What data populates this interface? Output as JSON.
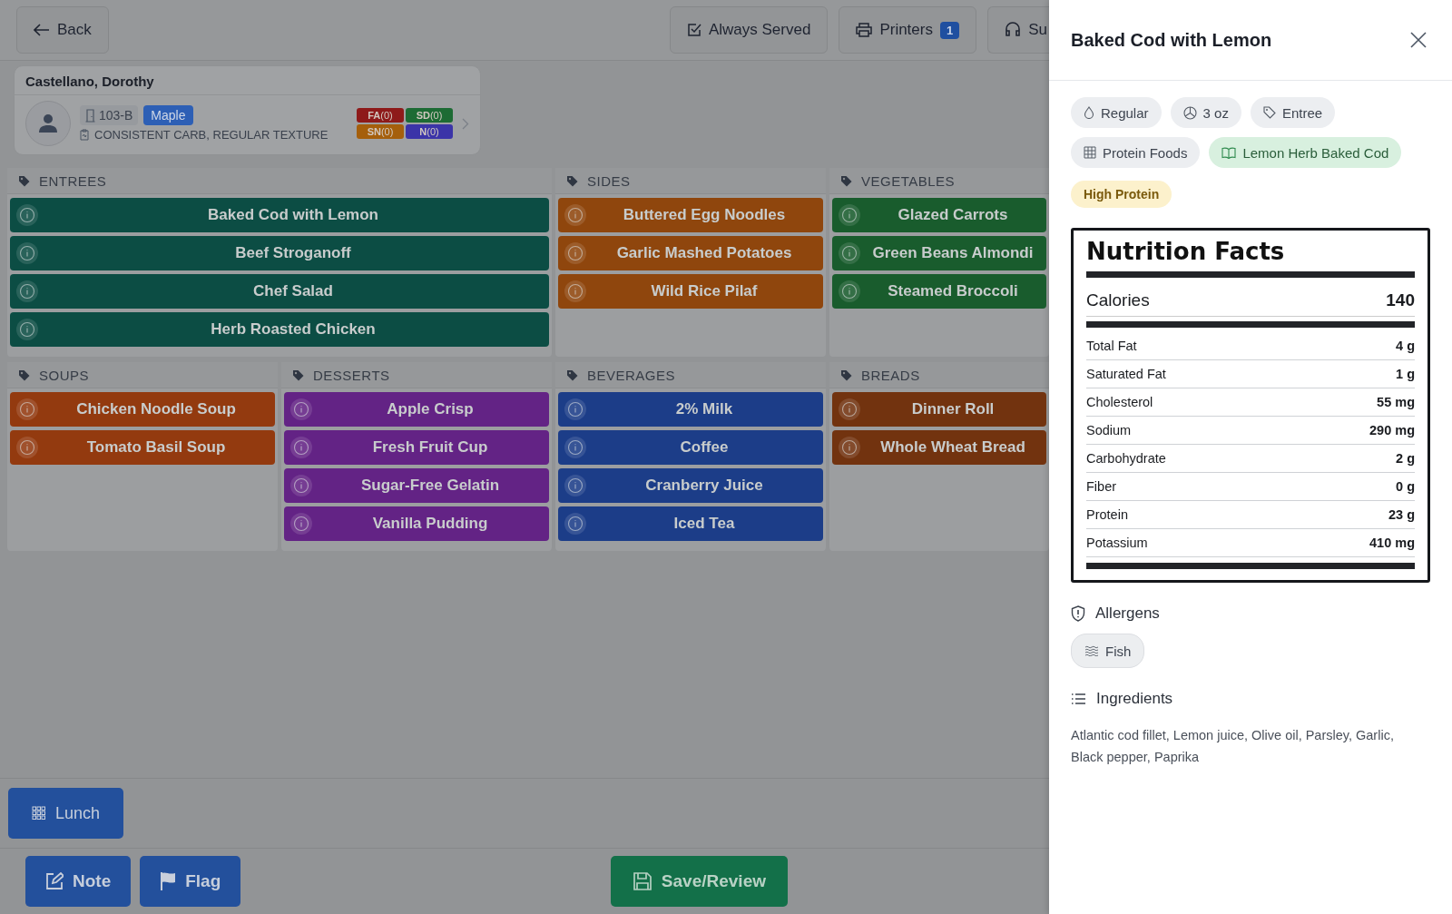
{
  "header": {
    "back": "Back",
    "buttons": [
      {
        "label": "Always Served"
      },
      {
        "label": "Printers",
        "badge": "1"
      },
      {
        "label": "Su"
      }
    ]
  },
  "patient": {
    "name": "Castellano, Dorothy",
    "room": "103-B",
    "unit": "Maple",
    "diet": "CONSISTENT CARB, REGULAR TEXTURE",
    "flags": [
      {
        "text": "**FA**(0)",
        "color": "#8e1a1a"
      },
      {
        "text": "**SD**(0)",
        "color": "#1d6b34"
      },
      {
        "text": "**SN**(0)",
        "color": "#a55f0c"
      },
      {
        "text": "**N**(0)",
        "color": "#3b34a8"
      }
    ]
  },
  "categories": [
    {
      "name": "ENTREES",
      "color": "#0c4d44",
      "wide": true,
      "items": [
        "Baked Cod with Lemon",
        "Beef Stroganoff",
        "Chef Salad",
        "Herb Roasted Chicken"
      ]
    },
    {
      "name": "SIDES",
      "color": "#8f460d",
      "wide": false,
      "items": [
        "Buttered Egg Noodles",
        "Garlic Mashed Potatoes",
        "Wild Rice Pilaf"
      ]
    },
    {
      "name": "VEGETABLES",
      "color": "#195c2d",
      "wide": false,
      "items": [
        "Glazed Carrots",
        "Green Beans Almondi",
        "Steamed Broccoli"
      ]
    },
    {
      "name": "SOUPS",
      "color": "#933a0f",
      "wide": false,
      "items": [
        "Chicken Noodle Soup",
        "Tomato Basil Soup"
      ]
    },
    {
      "name": "DESSERTS",
      "color": "#632385",
      "wide": false,
      "items": [
        "Apple Crisp",
        "Fresh Fruit Cup",
        "Sugar-Free Gelatin",
        "Vanilla Pudding"
      ]
    },
    {
      "name": "BEVERAGES",
      "color": "#1c3d88",
      "wide": false,
      "items": [
        "2% Milk",
        "Coffee",
        "Cranberry Juice",
        "Iced Tea"
      ]
    },
    {
      "name": "BREADS",
      "color": "#72330f",
      "wide": false,
      "items": [
        "Dinner Roll",
        "Whole Wheat Bread"
      ]
    }
  ],
  "meal": "Lunch",
  "footer": {
    "note": "Note",
    "flag": "Flag",
    "save": "Save/Review"
  },
  "panel": {
    "title": "Baked Cod with Lemon",
    "chips": [
      {
        "label": "Regular",
        "kind": "plain"
      },
      {
        "label": "3 oz",
        "kind": "plain"
      },
      {
        "label": "Entree",
        "kind": "plain"
      },
      {
        "label": "Protein Foods",
        "kind": "plain"
      },
      {
        "label": "Lemon Herb Baked Cod",
        "kind": "recipe"
      },
      {
        "label": "High Protein",
        "kind": "highlight"
      }
    ],
    "nutrition": {
      "title": "Nutrition Facts",
      "calories_label": "Calories",
      "calories": "140",
      "rows": [
        {
          "name": "Total Fat",
          "value": "4 g"
        },
        {
          "name": "Saturated Fat",
          "value": "1 g"
        },
        {
          "name": "Cholesterol",
          "value": "55 mg"
        },
        {
          "name": "Sodium",
          "value": "290 mg"
        },
        {
          "name": "Carbohydrate",
          "value": "2 g"
        },
        {
          "name": "Fiber",
          "value": "0 g"
        },
        {
          "name": "Protein",
          "value": "23 g"
        },
        {
          "name": "Potassium",
          "value": "410 mg"
        }
      ]
    },
    "allergens_title": "Allergens",
    "allergens": [
      "Fish"
    ],
    "ingredients_title": "Ingredients",
    "ingredients": "Atlantic cod fillet, Lemon juice, Olive oil, Parsley, Garlic, Black pepper, Paprika"
  }
}
